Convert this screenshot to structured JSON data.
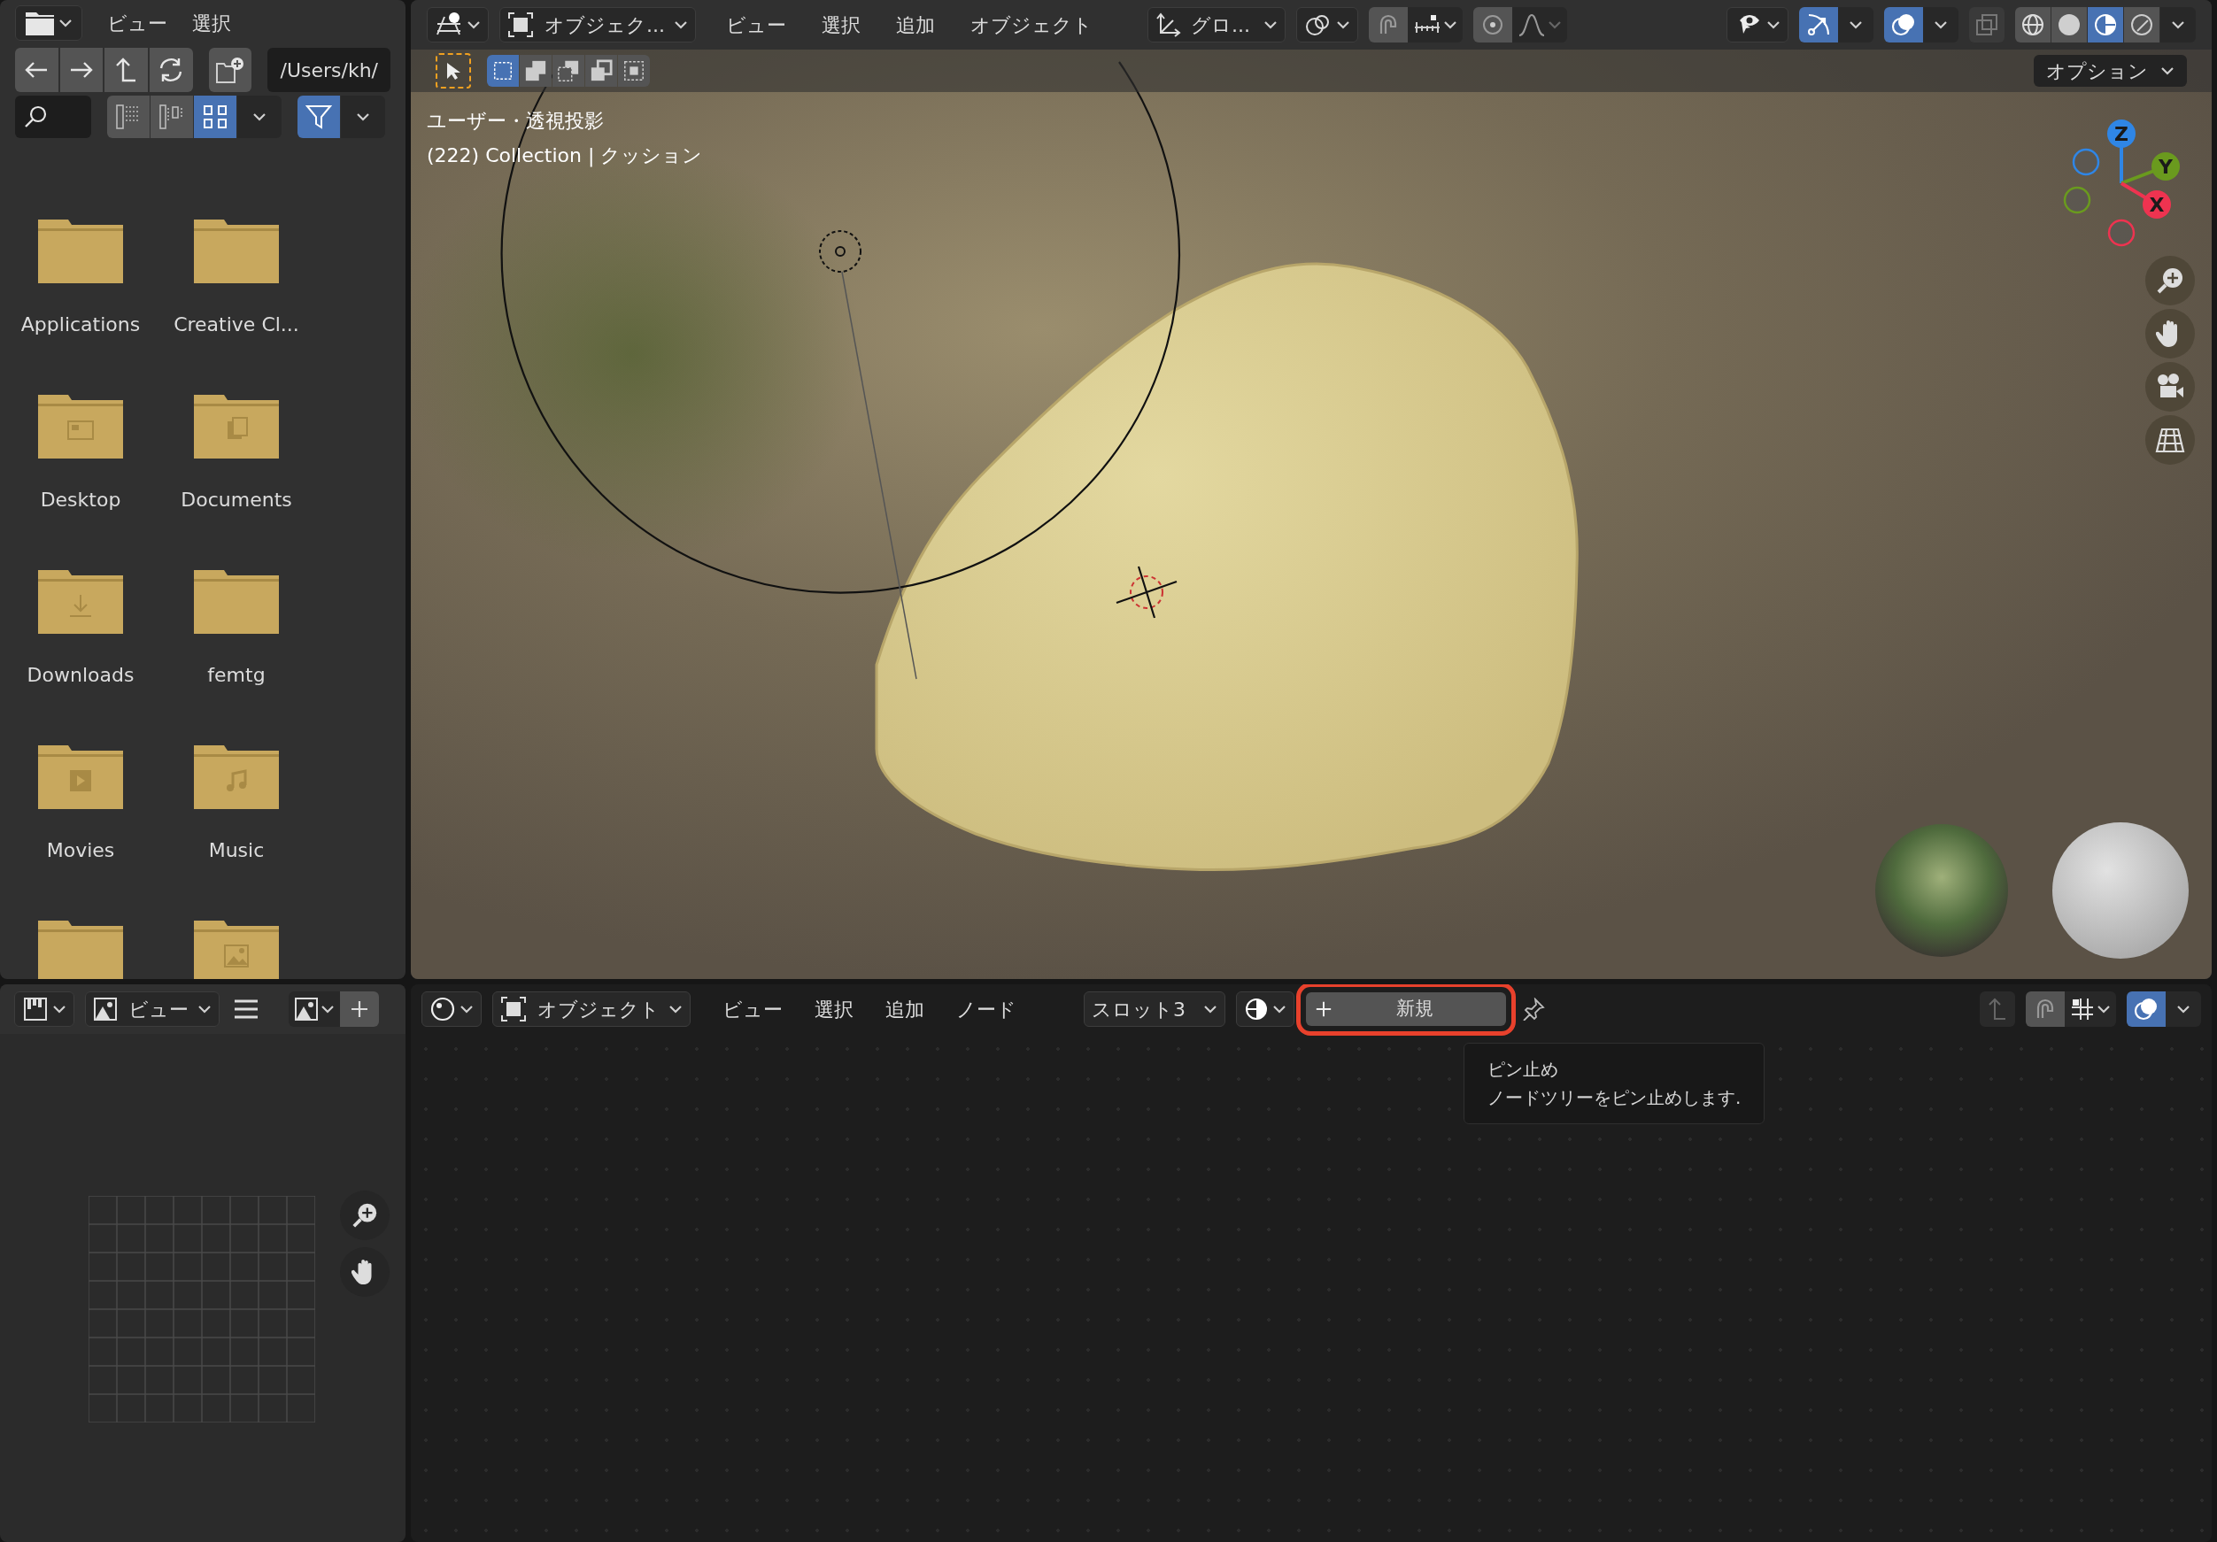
{
  "file_browser": {
    "menus": [
      "ビュー",
      "選択"
    ],
    "path": "/Users/kh/",
    "filter_on": true,
    "display_modes": [
      {
        "kind": "vertical_list",
        "selected": false
      },
      {
        "kind": "horizontal_list",
        "selected": false
      },
      {
        "kind": "thumbnails",
        "selected": true
      }
    ],
    "items": [
      {
        "kind": "plain",
        "name": "Applications"
      },
      {
        "kind": "plain",
        "name": "Creative Cl..."
      },
      {
        "kind": "desktop",
        "name": "Desktop"
      },
      {
        "kind": "documents",
        "name": "Documents"
      },
      {
        "kind": "downloads",
        "name": "Downloads"
      },
      {
        "kind": "plain",
        "name": "femtg"
      },
      {
        "kind": "movies",
        "name": "Movies"
      },
      {
        "kind": "music",
        "name": "Music"
      },
      {
        "kind": "plain"
      },
      {
        "kind": "pictures"
      }
    ]
  },
  "viewport": {
    "mode": "オブジェク...",
    "menus": [
      "ビュー",
      "選択",
      "追加",
      "オブジェクト"
    ],
    "orientation": "グロ...",
    "gizmos_on": true,
    "overlays_on": true,
    "xray_on": false,
    "shading_modes": [
      {
        "kind": "wireframe",
        "selected": false
      },
      {
        "kind": "solid",
        "selected": false
      },
      {
        "kind": "material",
        "selected": true
      },
      {
        "kind": "rendered",
        "selected": false
      }
    ],
    "select_modes": [
      {
        "kind": "new",
        "selected": true
      },
      {
        "kind": "extend",
        "selected": false
      },
      {
        "kind": "subtract",
        "selected": false
      },
      {
        "kind": "invert",
        "selected": false
      },
      {
        "kind": "intersect",
        "selected": false
      }
    ],
    "options": "オプション",
    "view_label": "ユーザー・透視投影",
    "object_label": "(222) Collection | クッション",
    "axes": [
      {
        "label": "Z",
        "color": "#2f86e6"
      },
      {
        "label": "Y",
        "color": "#6a9a1e"
      },
      {
        "label": "X",
        "color": "#ee3350"
      }
    ]
  },
  "image_editor": {
    "view_menu": "ビュー"
  },
  "node_editor": {
    "mode": "オブジェクト",
    "menus": [
      "ビュー",
      "選択",
      "追加",
      "ノード"
    ],
    "slot": "スロット3",
    "new_button": "新規",
    "new_button_highlighted": true,
    "overlays_on": true,
    "tooltip": {
      "title": "ピン止め",
      "description": "ノードツリーをピン止めします."
    }
  }
}
